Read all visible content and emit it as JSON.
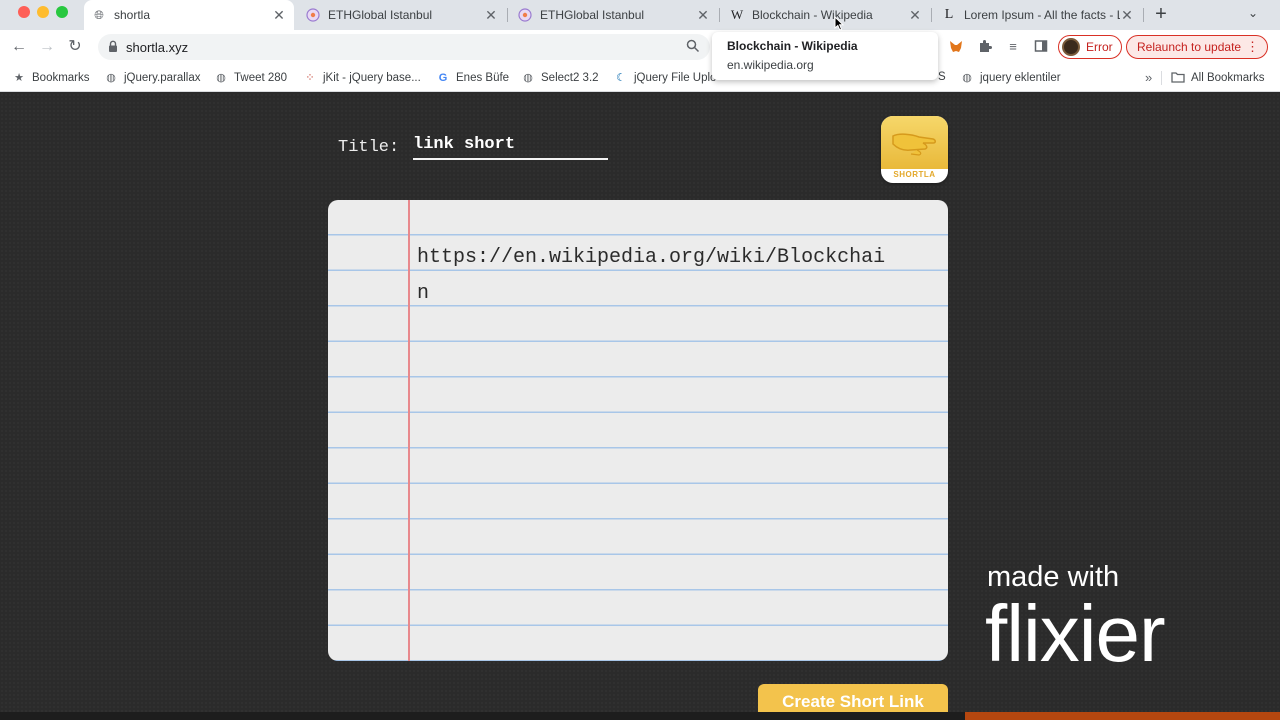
{
  "browser": {
    "tabs": [
      {
        "title": "shortla",
        "icon": "globe-icon",
        "active": true
      },
      {
        "title": "ETHGlobal Istanbul",
        "icon": "ethglobal-icon",
        "active": false
      },
      {
        "title": "ETHGlobal Istanbul",
        "icon": "ethglobal-icon",
        "active": false
      },
      {
        "title": "Blockchain - Wikipedia",
        "icon": "wikipedia-icon",
        "active": false
      },
      {
        "title": "Lorem Ipsum - All the facts - L",
        "icon": "lipsum-icon",
        "active": false
      }
    ],
    "url": "shortla.xyz",
    "profile_status": "Error",
    "relaunch_label": "Relaunch to update",
    "bookmarks": [
      "Bookmarks",
      "jQuery.parallax",
      "Tweet 280",
      "jKit - jQuery base...",
      "Enes Büfe",
      "Select2 3.2",
      "jQuery File Uplo",
      "S",
      "jquery eklentiler"
    ],
    "all_bookmarks_label": "All Bookmarks",
    "hovercard": {
      "title": "Blockchain - Wikipedia",
      "domain": "en.wikipedia.org"
    }
  },
  "page": {
    "title_label": "Title:",
    "title_value": "link short",
    "logo_text": "SHORTLA",
    "long_url": "https://en.wikipedia.org/wiki/Blockchain",
    "cta_label": "Create Short Link"
  },
  "watermark": {
    "made_with": "made with",
    "brand": "flixier"
  },
  "colors": {
    "accent": "#f3c34c",
    "background": "#2b2b2b",
    "paper": "#ececec",
    "rule": "#a8c6e8",
    "margin": "#e8888c"
  }
}
